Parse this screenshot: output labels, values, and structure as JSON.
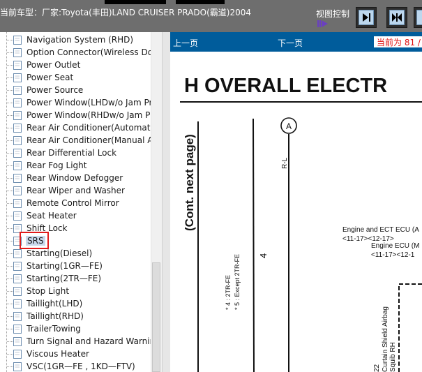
{
  "header": {
    "vehicle_label": "当前车型：厂家:Toyota(丰田)LAND CRUISER PRADO(霸道)2004",
    "view_control_label": "视图控制"
  },
  "tree": {
    "items": [
      {
        "label": "Navigation System (RHD)"
      },
      {
        "label": "Option Connector(Wireless Door"
      },
      {
        "label": "Power Outlet"
      },
      {
        "label": "Power Seat"
      },
      {
        "label": "Power Source"
      },
      {
        "label": "Power Window(LHDw/o Jam Pro"
      },
      {
        "label": "Power Window(RHDw/o Jam Pro"
      },
      {
        "label": "Rear Air Conditioner(Automatic"
      },
      {
        "label": "Rear Air Conditioner(Manual A/"
      },
      {
        "label": "Rear Differential Lock"
      },
      {
        "label": "Rear Fog Light"
      },
      {
        "label": "Rear Window Defogger"
      },
      {
        "label": "Rear Wiper and Washer"
      },
      {
        "label": "Remote Control Mirror"
      },
      {
        "label": "Seat Heater"
      },
      {
        "label": "Shift Lock"
      },
      {
        "label": "SRS"
      },
      {
        "label": "Starting(Diesel)"
      },
      {
        "label": "Starting(1GR—FE)"
      },
      {
        "label": "Starting(2TR—FE)"
      },
      {
        "label": "Stop Light"
      },
      {
        "label": "Taillight(LHD)"
      },
      {
        "label": "Taillight(RHD)"
      },
      {
        "label": "TrailerTowing"
      },
      {
        "label": "Turn Signal and Hazard Warning"
      },
      {
        "label": "Viscous Heater"
      },
      {
        "label": "VSC(1GR—FE , 1KD—FTV)"
      }
    ],
    "selected_index": 16
  },
  "viewer": {
    "prev_label": "上一页",
    "next_label": "下一页",
    "page_info": "当前为 81 /"
  },
  "diagram": {
    "title": "H  OVERALL ELECTR",
    "side_label": "(Cont.  next page)",
    "connector_letter": "A",
    "wire_label": "R-L",
    "wire_number": "4",
    "note_line1": "* 4 : 2TR-FE",
    "note_line2": "* 5 : Except 2TR-FE",
    "ecu_a": "Engine and ECT ECU (A",
    "ecu_a_ref": "<11-17><12-17>",
    "ecu_m": "Engine ECU (M",
    "ecu_m_ref": "<11-17><12-1",
    "airbag_label": "Curtain Shield Airbag",
    "squib_label": "Squib RH",
    "small_num": "22"
  },
  "colors": {
    "top_bar": "#6e6e6e",
    "nav_bar": "#005c9b",
    "selection_box": "#e11b1b",
    "page_info_text": "#e01010"
  }
}
